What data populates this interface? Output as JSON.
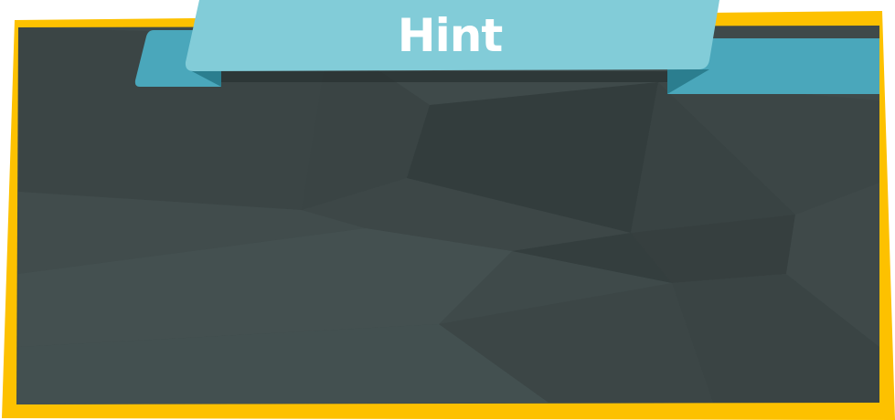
{
  "hint_panel": {
    "title": "Hint",
    "colors": {
      "frame": "#FDC100",
      "board": "#3F4A4A",
      "ribbon": "#82CCD8",
      "ribbon_fold": "#4AA7BB",
      "ribbon_shadow": "#2B7E8F"
    }
  }
}
